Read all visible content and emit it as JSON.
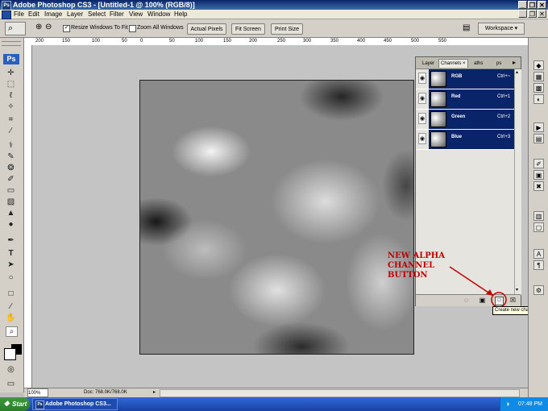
{
  "window": {
    "title": "Adobe Photoshop CS3 - [Untitled-1 @ 100% (RGB/8)]",
    "logo": "Ps",
    "controls": [
      "_",
      "❐",
      "✕"
    ]
  },
  "menubar": {
    "items": [
      "File",
      "Edit",
      "Image",
      "Layer",
      "Select",
      "Filter",
      "View",
      "Window",
      "Help"
    ],
    "doc_controls": [
      "_",
      "❐",
      "✕"
    ]
  },
  "options_bar": {
    "resize_windows_label": "Resize Windows To Fit",
    "resize_windows_checked": true,
    "zoom_all_label": "Zoom All Windows",
    "zoom_all_checked": false,
    "actual_pixels": "Actual Pixels",
    "fit_screen": "Fit Screen",
    "print_size": "Print Size",
    "workspace": "Workspace ▾"
  },
  "ruler": {
    "labels": [
      "200",
      "150",
      "100",
      "50",
      "0",
      "50",
      "100",
      "150",
      "200",
      "250",
      "300",
      "350",
      "400",
      "450",
      "500",
      "550"
    ]
  },
  "toolbox": {
    "badge": "Ps",
    "icons": [
      "move-icon",
      "marquee-icon",
      "lasso-icon",
      "magic-wand-icon",
      "crop-icon",
      "eyedropper-icon",
      "healing-brush-icon",
      "brush-icon",
      "clone-stamp-icon",
      "history-brush-icon",
      "eraser-icon",
      "gradient-icon",
      "blur-icon",
      "dodge-icon",
      "pen-icon",
      "type-icon",
      "path-select-icon",
      "shape-icon",
      "notes-icon",
      "eyedropper2-icon",
      "hand-icon",
      "zoom-icon"
    ]
  },
  "channels_panel": {
    "tabs": [
      "Layer",
      "Channels",
      "aths",
      "ps"
    ],
    "channels": [
      {
        "name": "RGB",
        "shortcut": "Ctrl+~"
      },
      {
        "name": "Red",
        "shortcut": "Ctrl+1"
      },
      {
        "name": "Green",
        "shortcut": "Ctrl+2"
      },
      {
        "name": "Blue",
        "shortcut": "Ctrl+3"
      }
    ]
  },
  "annotation": {
    "line1": "NEW ALPHA",
    "line2": "CHANNEL",
    "line3": "BUTTON",
    "color": "#c00000"
  },
  "tooltip": "Create new channel",
  "statusbar": {
    "zoom": "100%",
    "doc": "Doc: 768.0K/768.0K"
  },
  "taskbar": {
    "start": "Start",
    "item": "Adobe Photoshop CS3...",
    "clock": "07:48 PM"
  },
  "colors": {
    "title_bar": "#0a246a",
    "selection": "#0a246a",
    "annotation": "#c00000"
  }
}
